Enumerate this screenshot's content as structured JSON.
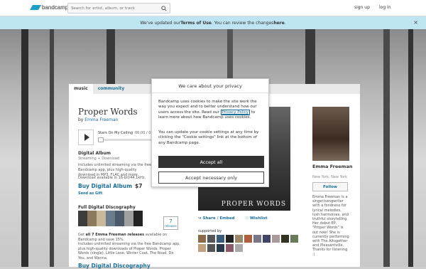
{
  "header": {
    "logo_text": "bandcamp",
    "search_placeholder": "Search for artist, album, or track",
    "signup_label": "sign up",
    "login_label": "log in"
  },
  "notice": {
    "prefix": "We've updated our ",
    "terms": "Terms of Use",
    "middle": ". You can review the changes ",
    "here": "here",
    "suffix": "."
  },
  "tabs": [
    {
      "label": "music"
    },
    {
      "label": "community"
    }
  ],
  "album": {
    "title": "Proper Words",
    "by_prefix": "by",
    "artist": "Emma Freeman",
    "cover_text": "PROPER WORDS"
  },
  "player": {
    "track": "Stars On My Ceiling",
    "time": "00:00 / 0",
    "progress": 0
  },
  "format": {
    "title": "Digital Album",
    "subtitle": "Streaming + Download",
    "description": "Includes unlimited streaming via the free Bandcamp app, plus high-quality download in MP3, FLAC and more.",
    "availability": "Download available in 16-bit/44.1kHz.",
    "buy_label": "Buy Digital Album",
    "price": "$7",
    "gift_label": "Send as Gift"
  },
  "discography": {
    "title": "Full Digital Discography",
    "release_count": "7",
    "release_label": "releases",
    "desc_get": "Get ",
    "desc_bold": "all 7 Emma Freeman releases",
    "desc_rest": " available on Bandcamp and save 15%.",
    "desc2": "Includes unlimited streaming via the free Bandcamp app, plus high-quality downloads of Proper Words, Proper Words (single), Little Love, Winter Coat, The Road, Do You, and Wanna.",
    "buy_label": "Buy Digital Discography"
  },
  "actions": {
    "share": "Share / Embed",
    "wishlist": "Wishlist",
    "supported_by": "supported by"
  },
  "artist": {
    "name": "Emma Freeman",
    "location": "New York, New York",
    "follow_label": "Follow",
    "bio": "Emma Freeman is a singer/songwriter with a fondness for lyrical melodies, lush harmonies, and truthful storytelling. Her debut EP, \"Proper Words\" is out now! She is currently performing with The Altogether and Pleasantville. Thanks for listening :)"
  },
  "cookie_modal": {
    "title": "We care about your privacy",
    "body_start": "Bandcamp uses cookies to make the site work the way you expect and to better understand how our users access the site. Read our ",
    "privacy_link": "Privacy Policy",
    "body_end": " to learn more about how Bandcamp uses cookies.",
    "body2": "You can update your cookie settings at any time by clicking the \"Cookie settings\" link at the bottom of any Bandcamp page.",
    "accept_all": "Accept all",
    "accept_necessary": "Accept necessary only"
  },
  "colors": {
    "accent": "#1a6f9a",
    "notice_bg": "#bfe4f2",
    "logo": "#1da0c3"
  }
}
